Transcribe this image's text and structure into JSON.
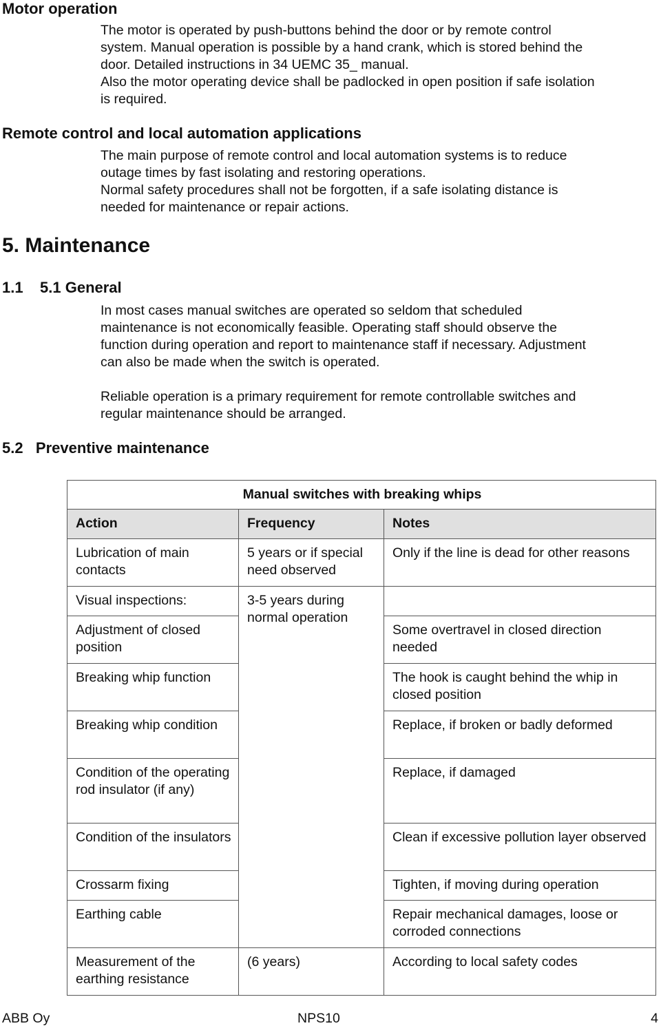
{
  "sections": {
    "motor_operation": {
      "heading": "Motor operation",
      "lines": [
        "The motor is operated by push-buttons behind the door or by remote control",
        "system. Manual operation is possible by a hand crank, which is stored behind the",
        "door. Detailed instructions in 34 UEMC 35_ manual.",
        "Also the motor operating device shall be padlocked in open position if safe isolation",
        "is required."
      ]
    },
    "remote_control": {
      "heading": "Remote control and local automation applications",
      "lines": [
        "The main purpose of remote control and local automation systems is to reduce",
        "outage times by fast isolating and restoring operations.",
        "Normal safety procedures shall not be forgotten, if a safe isolating distance is",
        "needed for maintenance or repair actions."
      ]
    },
    "maintenance": {
      "heading": "5. Maintenance"
    },
    "general": {
      "heading": "1.1    5.1 General",
      "para1_lines": [
        "In most cases manual switches are operated so seldom that scheduled",
        "maintenance is not economically feasible. Operating staff should observe the",
        "function during operation and report to maintenance staff if necessary. Adjustment",
        "can also be made when the switch is operated."
      ],
      "para2_lines": [
        "Reliable operation is a primary requirement for remote controllable switches and",
        "regular maintenance should be arranged."
      ]
    },
    "preventive": {
      "heading": "5.2   Preventive maintenance"
    }
  },
  "table": {
    "title": "Manual switches with breaking whips",
    "header_bg": "#e0e0e0",
    "columns": [
      "Action",
      "Frequency",
      "Notes"
    ],
    "rows": [
      {
        "action": "Lubrication of main contacts",
        "frequency": "5 years or if special need observed",
        "notes": "Only if the line is dead for other reasons"
      },
      {
        "action": "Visual inspections:",
        "frequency": "3-5 years during normal operation",
        "notes": ""
      },
      {
        "action": "Adjustment of closed position",
        "notes": "Some overtravel in closed direction needed"
      },
      {
        "action": "Breaking whip function",
        "notes": "The hook is caught behind the whip in closed position"
      },
      {
        "action": "Breaking whip condition",
        "notes": "Replace, if broken or badly deformed"
      },
      {
        "action": "Condition of the operating rod insulator (if any)",
        "notes": "Replace, if damaged"
      },
      {
        "action": "Condition of the insulators",
        "notes": "Clean if excessive pollution layer observed"
      },
      {
        "action": "Crossarm fixing",
        "notes": "Tighten, if moving during operation"
      },
      {
        "action": "Earthing cable",
        "notes": "Repair mechanical damages, loose or corroded connections"
      },
      {
        "action": "Measurement of the earthing resistance",
        "frequency": "(6 years)",
        "notes": "According to local safety codes"
      }
    ]
  },
  "footer": {
    "company": "ABB Oy",
    "doc_id": "NPS10",
    "page_number": "4"
  }
}
